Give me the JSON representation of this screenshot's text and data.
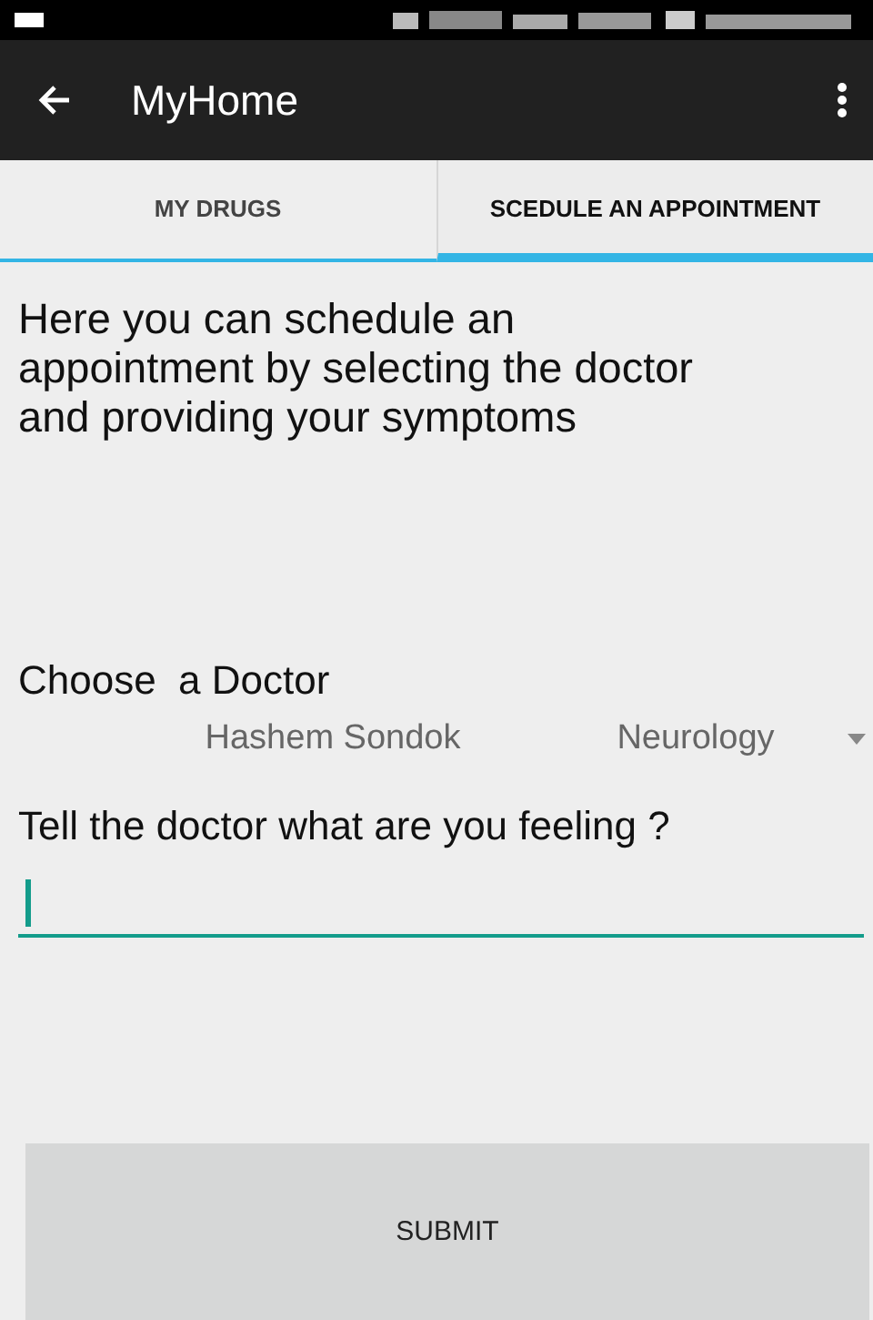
{
  "app_bar": {
    "title": "MyHome"
  },
  "tabs": [
    {
      "label": "MY DRUGS",
      "selected": false
    },
    {
      "label": "SCEDULE AN APPOINTMENT",
      "selected": true
    }
  ],
  "intro_lines": [
    "Here you can schedule an",
    "appointment by selecting the doctor",
    "and providing your symptoms"
  ],
  "doctor_label": "Choose  a Doctor",
  "doctor_spinner": {
    "name": "Hashem Sondok",
    "specialty": "Neurology"
  },
  "symptoms_label": "Tell the doctor what are you feeling ?",
  "symptoms_field": {
    "focused": true
  },
  "submit": "SUBMIT"
}
